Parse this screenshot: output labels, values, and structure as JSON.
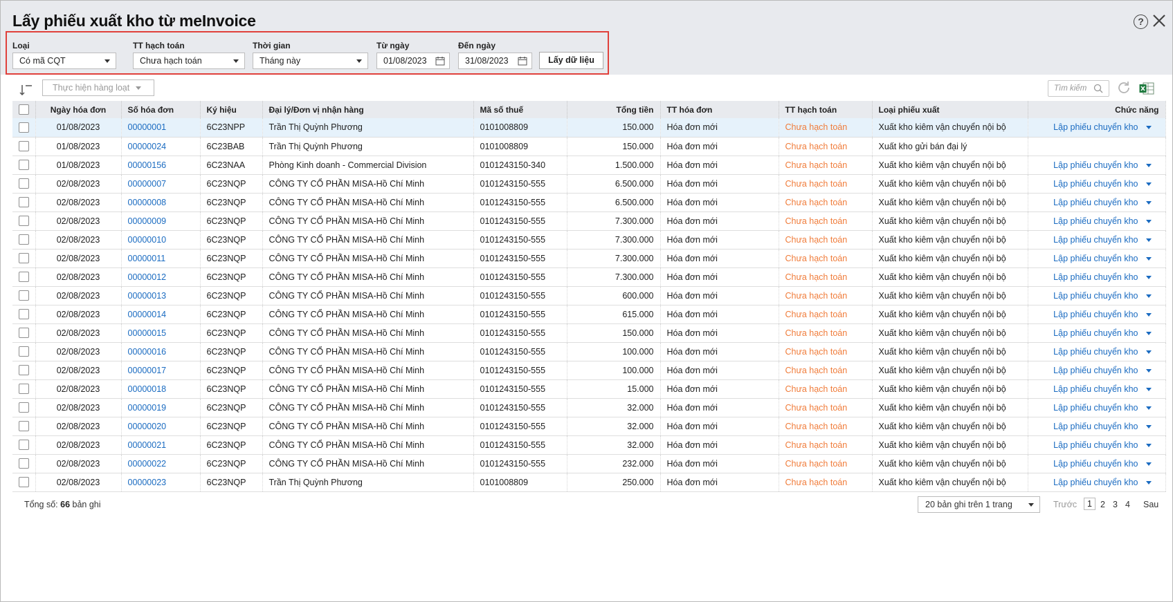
{
  "title": "Lấy phiếu xuất kho từ meInvoice",
  "filters": {
    "loai": {
      "label": "Loại",
      "value": "Có mã CQT"
    },
    "tt_hach_toan": {
      "label": "TT hạch toán",
      "value": "Chưa hạch toán"
    },
    "thoi_gian": {
      "label": "Thời gian",
      "value": "Tháng này"
    },
    "tu_ngay": {
      "label": "Từ ngày",
      "value": "01/08/2023"
    },
    "den_ngay": {
      "label": "Đến ngày",
      "value": "31/08/2023"
    },
    "fetch_button": "Lấy dữ liệu"
  },
  "toolbar": {
    "batch_button": "Thực hiện hàng loạt",
    "search_placeholder": "Tìm kiếm"
  },
  "columns": [
    "Ngày hóa đơn",
    "Số hóa đơn",
    "Ký hiệu",
    "Đại lý/Đơn vị nhận hàng",
    "Mã số thuế",
    "Tổng tiền",
    "TT hóa đơn",
    "TT hạch toán",
    "Loại phiếu xuất",
    "Chức năng"
  ],
  "rows": [
    {
      "date": "01/08/2023",
      "invoice_no": "00000001",
      "symbol": "6C23NPP",
      "receiver": "Trần Thị Quỳnh Phương",
      "tax_code": "0101008809",
      "total": "150.000",
      "invoice_status": "Hóa đơn mới",
      "accounting_status": "Chưa hạch toán",
      "type": "Xuất kho kiêm vận chuyển nội bộ",
      "action": "Lập phiếu chuyển kho"
    },
    {
      "date": "01/08/2023",
      "invoice_no": "00000024",
      "symbol": "6C23BAB",
      "receiver": "Trần Thị Quỳnh Phương",
      "tax_code": "0101008809",
      "total": "150.000",
      "invoice_status": "Hóa đơn mới",
      "accounting_status": "Chưa hạch toán",
      "type": "Xuất kho gửi bán đại lý",
      "action": ""
    },
    {
      "date": "01/08/2023",
      "invoice_no": "00000156",
      "symbol": "6C23NAA",
      "receiver": "Phòng Kinh doanh - Commercial Division",
      "tax_code": "0101243150-340",
      "total": "1.500.000",
      "invoice_status": "Hóa đơn mới",
      "accounting_status": "Chưa hạch toán",
      "type": "Xuất kho kiêm vận chuyển nội bộ",
      "action": "Lập phiếu chuyển kho"
    },
    {
      "date": "02/08/2023",
      "invoice_no": "00000007",
      "symbol": "6C23NQP",
      "receiver": "CÔNG TY CỔ PHẦN MISA-Hồ Chí Minh",
      "tax_code": "0101243150-555",
      "total": "6.500.000",
      "invoice_status": "Hóa đơn mới",
      "accounting_status": "Chưa hạch toán",
      "type": "Xuất kho kiêm vận chuyển nội bộ",
      "action": "Lập phiếu chuyển kho"
    },
    {
      "date": "02/08/2023",
      "invoice_no": "00000008",
      "symbol": "6C23NQP",
      "receiver": "CÔNG TY CỔ PHẦN MISA-Hồ Chí Minh",
      "tax_code": "0101243150-555",
      "total": "6.500.000",
      "invoice_status": "Hóa đơn mới",
      "accounting_status": "Chưa hạch toán",
      "type": "Xuất kho kiêm vận chuyển nội bộ",
      "action": "Lập phiếu chuyển kho"
    },
    {
      "date": "02/08/2023",
      "invoice_no": "00000009",
      "symbol": "6C23NQP",
      "receiver": "CÔNG TY CỔ PHẦN MISA-Hồ Chí Minh",
      "tax_code": "0101243150-555",
      "total": "7.300.000",
      "invoice_status": "Hóa đơn mới",
      "accounting_status": "Chưa hạch toán",
      "type": "Xuất kho kiêm vận chuyển nội bộ",
      "action": "Lập phiếu chuyển kho"
    },
    {
      "date": "02/08/2023",
      "invoice_no": "00000010",
      "symbol": "6C23NQP",
      "receiver": "CÔNG TY CỔ PHẦN MISA-Hồ Chí Minh",
      "tax_code": "0101243150-555",
      "total": "7.300.000",
      "invoice_status": "Hóa đơn mới",
      "accounting_status": "Chưa hạch toán",
      "type": "Xuất kho kiêm vận chuyển nội bộ",
      "action": "Lập phiếu chuyển kho"
    },
    {
      "date": "02/08/2023",
      "invoice_no": "00000011",
      "symbol": "6C23NQP",
      "receiver": "CÔNG TY CỔ PHẦN MISA-Hồ Chí Minh",
      "tax_code": "0101243150-555",
      "total": "7.300.000",
      "invoice_status": "Hóa đơn mới",
      "accounting_status": "Chưa hạch toán",
      "type": "Xuất kho kiêm vận chuyển nội bộ",
      "action": "Lập phiếu chuyển kho"
    },
    {
      "date": "02/08/2023",
      "invoice_no": "00000012",
      "symbol": "6C23NQP",
      "receiver": "CÔNG TY CỔ PHẦN MISA-Hồ Chí Minh",
      "tax_code": "0101243150-555",
      "total": "7.300.000",
      "invoice_status": "Hóa đơn mới",
      "accounting_status": "Chưa hạch toán",
      "type": "Xuất kho kiêm vận chuyển nội bộ",
      "action": "Lập phiếu chuyển kho"
    },
    {
      "date": "02/08/2023",
      "invoice_no": "00000013",
      "symbol": "6C23NQP",
      "receiver": "CÔNG TY CỔ PHẦN MISA-Hồ Chí Minh",
      "tax_code": "0101243150-555",
      "total": "600.000",
      "invoice_status": "Hóa đơn mới",
      "accounting_status": "Chưa hạch toán",
      "type": "Xuất kho kiêm vận chuyển nội bộ",
      "action": "Lập phiếu chuyển kho"
    },
    {
      "date": "02/08/2023",
      "invoice_no": "00000014",
      "symbol": "6C23NQP",
      "receiver": "CÔNG TY CỔ PHẦN MISA-Hồ Chí Minh",
      "tax_code": "0101243150-555",
      "total": "615.000",
      "invoice_status": "Hóa đơn mới",
      "accounting_status": "Chưa hạch toán",
      "type": "Xuất kho kiêm vận chuyển nội bộ",
      "action": "Lập phiếu chuyển kho"
    },
    {
      "date": "02/08/2023",
      "invoice_no": "00000015",
      "symbol": "6C23NQP",
      "receiver": "CÔNG TY CỔ PHẦN MISA-Hồ Chí Minh",
      "tax_code": "0101243150-555",
      "total": "150.000",
      "invoice_status": "Hóa đơn mới",
      "accounting_status": "Chưa hạch toán",
      "type": "Xuất kho kiêm vận chuyển nội bộ",
      "action": "Lập phiếu chuyển kho"
    },
    {
      "date": "02/08/2023",
      "invoice_no": "00000016",
      "symbol": "6C23NQP",
      "receiver": "CÔNG TY CỔ PHẦN MISA-Hồ Chí Minh",
      "tax_code": "0101243150-555",
      "total": "100.000",
      "invoice_status": "Hóa đơn mới",
      "accounting_status": "Chưa hạch toán",
      "type": "Xuất kho kiêm vận chuyển nội bộ",
      "action": "Lập phiếu chuyển kho"
    },
    {
      "date": "02/08/2023",
      "invoice_no": "00000017",
      "symbol": "6C23NQP",
      "receiver": "CÔNG TY CỔ PHẦN MISA-Hồ Chí Minh",
      "tax_code": "0101243150-555",
      "total": "100.000",
      "invoice_status": "Hóa đơn mới",
      "accounting_status": "Chưa hạch toán",
      "type": "Xuất kho kiêm vận chuyển nội bộ",
      "action": "Lập phiếu chuyển kho"
    },
    {
      "date": "02/08/2023",
      "invoice_no": "00000018",
      "symbol": "6C23NQP",
      "receiver": "CÔNG TY CỔ PHẦN MISA-Hồ Chí Minh",
      "tax_code": "0101243150-555",
      "total": "15.000",
      "invoice_status": "Hóa đơn mới",
      "accounting_status": "Chưa hạch toán",
      "type": "Xuất kho kiêm vận chuyển nội bộ",
      "action": "Lập phiếu chuyển kho"
    },
    {
      "date": "02/08/2023",
      "invoice_no": "00000019",
      "symbol": "6C23NQP",
      "receiver": "CÔNG TY CỔ PHẦN MISA-Hồ Chí Minh",
      "tax_code": "0101243150-555",
      "total": "32.000",
      "invoice_status": "Hóa đơn mới",
      "accounting_status": "Chưa hạch toán",
      "type": "Xuất kho kiêm vận chuyển nội bộ",
      "action": "Lập phiếu chuyển kho"
    },
    {
      "date": "02/08/2023",
      "invoice_no": "00000020",
      "symbol": "6C23NQP",
      "receiver": "CÔNG TY CỔ PHẦN MISA-Hồ Chí Minh",
      "tax_code": "0101243150-555",
      "total": "32.000",
      "invoice_status": "Hóa đơn mới",
      "accounting_status": "Chưa hạch toán",
      "type": "Xuất kho kiêm vận chuyển nội bộ",
      "action": "Lập phiếu chuyển kho"
    },
    {
      "date": "02/08/2023",
      "invoice_no": "00000021",
      "symbol": "6C23NQP",
      "receiver": "CÔNG TY CỔ PHẦN MISA-Hồ Chí Minh",
      "tax_code": "0101243150-555",
      "total": "32.000",
      "invoice_status": "Hóa đơn mới",
      "accounting_status": "Chưa hạch toán",
      "type": "Xuất kho kiêm vận chuyển nội bộ",
      "action": "Lập phiếu chuyển kho"
    },
    {
      "date": "02/08/2023",
      "invoice_no": "00000022",
      "symbol": "6C23NQP",
      "receiver": "CÔNG TY CỔ PHẦN MISA-Hồ Chí Minh",
      "tax_code": "0101243150-555",
      "total": "232.000",
      "invoice_status": "Hóa đơn mới",
      "accounting_status": "Chưa hạch toán",
      "type": "Xuất kho kiêm vận chuyển nội bộ",
      "action": "Lập phiếu chuyển kho"
    },
    {
      "date": "02/08/2023",
      "invoice_no": "00000023",
      "symbol": "6C23NQP",
      "receiver": "Trần Thị Quỳnh Phương",
      "tax_code": "0101008809",
      "total": "250.000",
      "invoice_status": "Hóa đơn mới",
      "accounting_status": "Chưa hạch toán",
      "type": "Xuất kho kiêm vận chuyển nội bộ",
      "action": "Lập phiếu chuyển kho"
    }
  ],
  "footer": {
    "total_prefix": "Tổng số:",
    "total_count": "66",
    "total_suffix": "bản ghi",
    "page_size": "20 bản ghi trên 1 trang",
    "prev": "Trước",
    "pages": [
      "1",
      "2",
      "3",
      "4"
    ],
    "current_page": "1",
    "next": "Sau"
  },
  "colors": {
    "header_bg": "#e8eaee",
    "highlight_border": "#e0403b",
    "link": "#1a6bc1",
    "orange_status": "#f07c3a",
    "selected_row": "#e6f2fb"
  },
  "icons": [
    "help-icon",
    "close-icon",
    "calendar-icon",
    "sort-icon",
    "search-icon",
    "refresh-icon",
    "excel-icon"
  ]
}
